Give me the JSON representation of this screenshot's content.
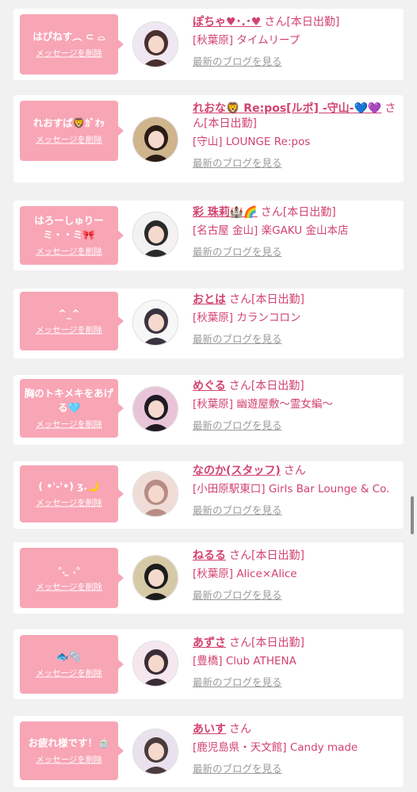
{
  "colors": {
    "bubble": "#f8a5b5",
    "accent": "#d2436f",
    "muted": "#9a9a9a",
    "page_bg": "#f1f1f1"
  },
  "cards": [
    {
      "message": "はぴねす︵ ⊂ ⌓",
      "delete_label": "メッセージを削除",
      "name": "ぽちゃ♥･.･♥",
      "suffix": "さん[本日出勤]",
      "shop": "[秋葉原] タイムリープ",
      "blog_label": "最新のブログを見る",
      "avatar_colors": [
        "#efe8f2",
        "#4a2f2f"
      ]
    },
    {
      "message": "れおすぱ🦁ｶﾞｵｯ",
      "delete_label": "メッセージを削除",
      "name": "れおな🦁 Re:pos[ルポ] -守山-💙💜",
      "suffix": "さん[本日出勤]",
      "shop": "[守山] LOUNGE Re:pos",
      "blog_label": "最新のブログを見る",
      "avatar_colors": [
        "#cfb48c",
        "#2b1b14"
      ]
    },
    {
      "message": "はろーしゅりーミ・・ミ🎀",
      "delete_label": "メッセージを削除",
      "name": "彩 珠莉🏰🌈",
      "suffix": "さん[本日出勤]",
      "shop": "[名古屋 金山] 楽GAKU 金山本店",
      "blog_label": "最新のブログを見る",
      "avatar_colors": [
        "#f4f1f3",
        "#2a2a2a"
      ]
    },
    {
      "message": "^_^",
      "delete_label": "メッセージを削除",
      "name": "おとは",
      "suffix": "さん[本日出勤]",
      "shop": "[秋葉原] カランコロン",
      "blog_label": "最新のブログを見る",
      "avatar_colors": [
        "#f7f7f8",
        "#3b3340"
      ]
    },
    {
      "message": "胸のトキメキをあげる🩵",
      "delete_label": "メッセージを削除",
      "name": "めぐる",
      "suffix": "さん[本日出勤]",
      "shop": "[秋葉原] 幽遊屋敷〜霊女編〜",
      "blog_label": "最新のブログを見る",
      "avatar_colors": [
        "#e9c4d8",
        "#1f1a24"
      ]
    },
    {
      "message": "( •'-'•) ʒ.🌙",
      "delete_label": "メッセージを削除",
      "name": "なのか(スタッフ)",
      "suffix": "さん",
      "shop": "[小田原駅東口] Girls Bar Lounge & Co.",
      "blog_label": "最新のブログを見る",
      "avatar_colors": [
        "#f0dcd6",
        "#b88c86"
      ]
    },
    {
      "message": "ᐢ.  ̫ .ᐢ",
      "delete_label": "メッセージを削除",
      "name": "ねるる",
      "suffix": "さん[本日出勤]",
      "shop": "[秋葉原] Alice×Alice",
      "blog_label": "最新のブログを見る",
      "avatar_colors": [
        "#d6c9a6",
        "#1c1c1c"
      ]
    },
    {
      "message": "🐟🫧",
      "delete_label": "メッセージを削除",
      "name": "あずさ",
      "suffix": "さん[本日出勤]",
      "shop": "[豊橋] Club ATHENA",
      "blog_label": "最新のブログを見る",
      "avatar_colors": [
        "#f6e7ef",
        "#3a2d35"
      ]
    },
    {
      "message": "お疲れ様です！🍵",
      "delete_label": "メッセージを削除",
      "name": "あいす",
      "suffix": "さん",
      "shop": "[鹿児島県・天文館] Candy made",
      "blog_label": "最新のブログを見る",
      "avatar_colors": [
        "#e9e2ee",
        "#4a3b3c"
      ]
    }
  ]
}
